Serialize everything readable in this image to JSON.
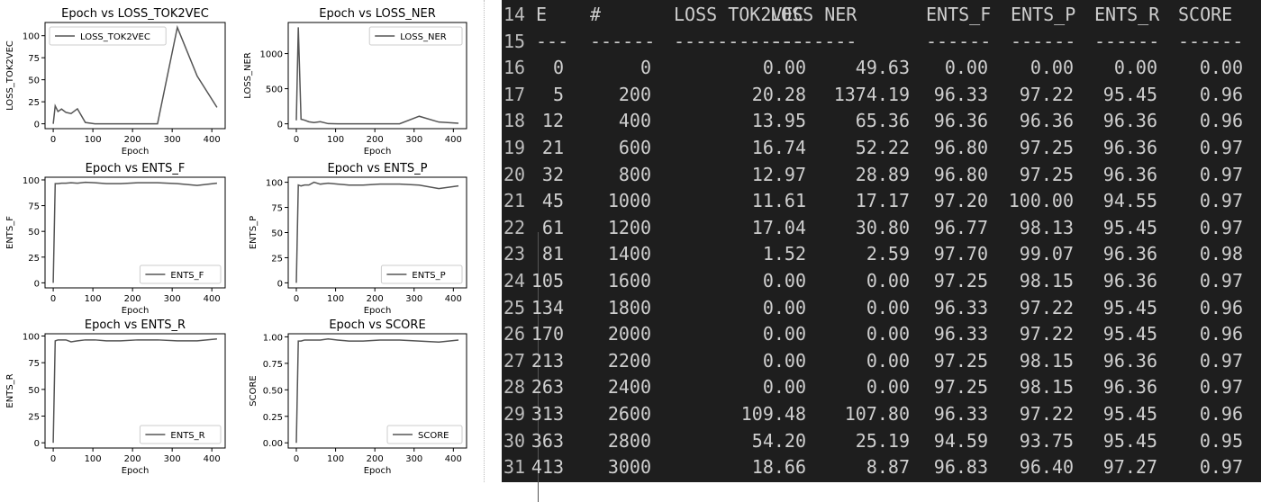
{
  "chart_data": [
    {
      "type": "line",
      "title": "Epoch vs LOSS_TOK2VEC",
      "xlabel": "Epoch",
      "ylabel": "LOSS_TOK2VEC",
      "legend": "upper-left",
      "series_name": "LOSS_TOK2VEC",
      "x": [
        0,
        5,
        12,
        21,
        32,
        45,
        61,
        81,
        105,
        134,
        170,
        213,
        263,
        313,
        363,
        413
      ],
      "y": [
        0,
        20.28,
        13.95,
        16.74,
        12.97,
        11.61,
        17.04,
        1.52,
        0,
        0,
        0,
        0,
        0,
        109.48,
        54.2,
        18.66
      ],
      "ylim": [
        -5.5,
        115
      ],
      "yticks": [
        "0",
        "25",
        "50",
        "75",
        "100"
      ],
      "ytickvals": [
        0,
        25,
        50,
        75,
        100
      ],
      "xticks": [
        0,
        100,
        200,
        300,
        400
      ],
      "xlim": [
        -20.65,
        433.65
      ]
    },
    {
      "type": "line",
      "title": "Epoch vs LOSS_NER",
      "xlabel": "Epoch",
      "ylabel": "LOSS_NER",
      "legend": "upper-right",
      "series_name": "LOSS_NER",
      "x": [
        0,
        5,
        12,
        21,
        32,
        45,
        61,
        81,
        105,
        134,
        170,
        213,
        263,
        313,
        363,
        413
      ],
      "y": [
        49.63,
        1374.19,
        65.36,
        52.22,
        28.89,
        17.17,
        30.8,
        2.59,
        0,
        0,
        0,
        0,
        0,
        107.8,
        25.19,
        8.87
      ],
      "ylim": [
        -68.7,
        1442.9
      ],
      "yticks": [
        "0",
        "500",
        "1000"
      ],
      "ytickvals": [
        0,
        500,
        1000
      ],
      "xticks": [
        0,
        100,
        200,
        300,
        400
      ],
      "xlim": [
        -20.65,
        433.65
      ]
    },
    {
      "type": "line",
      "title": "Epoch vs ENTS_F",
      "xlabel": "Epoch",
      "ylabel": "ENTS_F",
      "legend": "lower-right",
      "series_name": "ENTS_F",
      "x": [
        0,
        5,
        12,
        21,
        32,
        45,
        61,
        81,
        105,
        134,
        170,
        213,
        263,
        313,
        363,
        413
      ],
      "y": [
        0,
        96.33,
        96.36,
        96.8,
        96.8,
        97.2,
        96.77,
        97.7,
        97.25,
        96.33,
        96.33,
        97.25,
        97.25,
        96.33,
        94.59,
        96.83
      ],
      "ylim": [
        -4.9,
        102.6
      ],
      "yticks": [
        "0",
        "25",
        "50",
        "75",
        "100"
      ],
      "ytickvals": [
        0,
        25,
        50,
        75,
        100
      ],
      "xticks": [
        0,
        100,
        200,
        300,
        400
      ],
      "xlim": [
        -20.65,
        433.65
      ]
    },
    {
      "type": "line",
      "title": "Epoch vs ENTS_P",
      "xlabel": "Epoch",
      "ylabel": "ENTS_P",
      "legend": "lower-right",
      "series_name": "ENTS_P",
      "x": [
        0,
        5,
        12,
        21,
        32,
        45,
        61,
        81,
        105,
        134,
        170,
        213,
        263,
        313,
        363,
        413
      ],
      "y": [
        0,
        97.22,
        96.36,
        97.25,
        97.25,
        100.0,
        98.13,
        99.07,
        98.15,
        97.22,
        97.22,
        98.15,
        98.15,
        97.22,
        93.75,
        96.4
      ],
      "ylim": [
        -5,
        105
      ],
      "yticks": [
        "0",
        "25",
        "50",
        "75",
        "100"
      ],
      "ytickvals": [
        0,
        25,
        50,
        75,
        100
      ],
      "xticks": [
        0,
        100,
        200,
        300,
        400
      ],
      "xlim": [
        -20.65,
        433.65
      ]
    },
    {
      "type": "line",
      "title": "Epoch vs ENTS_R",
      "xlabel": "Epoch",
      "ylabel": "ENTS_R",
      "legend": "lower-right",
      "series_name": "ENTS_R",
      "x": [
        0,
        5,
        12,
        21,
        32,
        45,
        61,
        81,
        105,
        134,
        170,
        213,
        263,
        313,
        363,
        413
      ],
      "y": [
        0,
        95.45,
        96.36,
        96.36,
        96.36,
        94.55,
        95.45,
        96.36,
        96.36,
        95.45,
        95.45,
        96.36,
        96.36,
        95.45,
        95.45,
        97.27
      ],
      "ylim": [
        -4.9,
        102.1
      ],
      "yticks": [
        "0",
        "25",
        "50",
        "75",
        "100"
      ],
      "ytickvals": [
        0,
        25,
        50,
        75,
        100
      ],
      "xticks": [
        0,
        100,
        200,
        300,
        400
      ],
      "xlim": [
        -20.65,
        433.65
      ]
    },
    {
      "type": "line",
      "title": "Epoch vs SCORE",
      "xlabel": "Epoch",
      "ylabel": "SCORE",
      "legend": "lower-right",
      "series_name": "SCORE",
      "x": [
        0,
        5,
        12,
        21,
        32,
        45,
        61,
        81,
        105,
        134,
        170,
        213,
        263,
        313,
        363,
        413
      ],
      "y": [
        0,
        0.96,
        0.96,
        0.97,
        0.97,
        0.97,
        0.97,
        0.98,
        0.97,
        0.96,
        0.96,
        0.97,
        0.97,
        0.96,
        0.95,
        0.97
      ],
      "ylim": [
        -0.049,
        1.029
      ],
      "yticks": [
        "0.00",
        "0.25",
        "0.50",
        "0.75",
        "1.00"
      ],
      "ytickvals": [
        0,
        0.25,
        0.5,
        0.75,
        1
      ],
      "xticks": [
        0,
        100,
        200,
        300,
        400
      ],
      "xlim": [
        -20.65,
        433.65
      ]
    }
  ],
  "terminal": {
    "header": {
      "line": "14",
      "cells": [
        "E",
        "#",
        "LOSS TOK2VEC",
        "LOSS NER",
        "ENTS_F",
        "ENTS_P",
        "ENTS_R",
        "SCORE"
      ]
    },
    "separator": {
      "line": "15",
      "cells": [
        "---",
        "------",
        "------------",
        "--------",
        "------",
        "------",
        "------",
        "------"
      ]
    },
    "rows": [
      {
        "line": "16",
        "cells": [
          "0",
          "0",
          "0.00",
          "49.63",
          "0.00",
          "0.00",
          "0.00",
          "0.00"
        ]
      },
      {
        "line": "17",
        "cells": [
          "5",
          "200",
          "20.28",
          "1374.19",
          "96.33",
          "97.22",
          "95.45",
          "0.96"
        ]
      },
      {
        "line": "18",
        "cells": [
          "12",
          "400",
          "13.95",
          "65.36",
          "96.36",
          "96.36",
          "96.36",
          "0.96"
        ]
      },
      {
        "line": "19",
        "cells": [
          "21",
          "600",
          "16.74",
          "52.22",
          "96.80",
          "97.25",
          "96.36",
          "0.97"
        ]
      },
      {
        "line": "20",
        "cells": [
          "32",
          "800",
          "12.97",
          "28.89",
          "96.80",
          "97.25",
          "96.36",
          "0.97"
        ]
      },
      {
        "line": "21",
        "cells": [
          "45",
          "1000",
          "11.61",
          "17.17",
          "97.20",
          "100.00",
          "94.55",
          "0.97"
        ]
      },
      {
        "line": "22",
        "cells": [
          "61",
          "1200",
          "17.04",
          "30.80",
          "96.77",
          "98.13",
          "95.45",
          "0.97"
        ]
      },
      {
        "line": "23",
        "cells": [
          "81",
          "1400",
          "1.52",
          "2.59",
          "97.70",
          "99.07",
          "96.36",
          "0.98"
        ]
      },
      {
        "line": "24",
        "cells": [
          "105",
          "1600",
          "0.00",
          "0.00",
          "97.25",
          "98.15",
          "96.36",
          "0.97"
        ]
      },
      {
        "line": "25",
        "cells": [
          "134",
          "1800",
          "0.00",
          "0.00",
          "96.33",
          "97.22",
          "95.45",
          "0.96"
        ]
      },
      {
        "line": "26",
        "cells": [
          "170",
          "2000",
          "0.00",
          "0.00",
          "96.33",
          "97.22",
          "95.45",
          "0.96"
        ]
      },
      {
        "line": "27",
        "cells": [
          "213",
          "2200",
          "0.00",
          "0.00",
          "97.25",
          "98.15",
          "96.36",
          "0.97"
        ]
      },
      {
        "line": "28",
        "cells": [
          "263",
          "2400",
          "0.00",
          "0.00",
          "97.25",
          "98.15",
          "96.36",
          "0.97"
        ]
      },
      {
        "line": "29",
        "cells": [
          "313",
          "2600",
          "109.48",
          "107.80",
          "96.33",
          "97.22",
          "95.45",
          "0.96"
        ]
      },
      {
        "line": "30",
        "cells": [
          "363",
          "2800",
          "54.20",
          "25.19",
          "94.59",
          "93.75",
          "95.45",
          "0.95"
        ]
      },
      {
        "line": "31",
        "cells": [
          "413",
          "3000",
          "18.66",
          "8.87",
          "96.83",
          "96.40",
          "97.27",
          "0.97"
        ]
      }
    ]
  },
  "colors": {
    "line": "#555555",
    "terminal_bg": "#1e1e1e",
    "terminal_text": "#cfcfcf"
  }
}
